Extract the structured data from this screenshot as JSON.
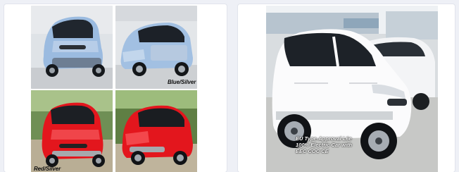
{
  "left_card": {
    "captions": {
      "blue_silver": "Blue/Silver",
      "red_silver": "Red/Silver"
    },
    "images": [
      {
        "icon": "car-photo-blue-front",
        "color": "#8fb0d6"
      },
      {
        "icon": "car-photo-blue-side",
        "color": "#8fb0d6"
      },
      {
        "icon": "car-photo-red-front",
        "color": "#e3161d"
      },
      {
        "icon": "car-photo-red-side",
        "color": "#e3161d"
      }
    ]
  },
  "right_card": {
    "hero": {
      "icon": "car-photo-white-hero",
      "color": "#ffffff",
      "text_lines": [
        "EU Type-Approval L6e",
        "100% Electric Car with",
        "EEC COC CE"
      ]
    }
  }
}
